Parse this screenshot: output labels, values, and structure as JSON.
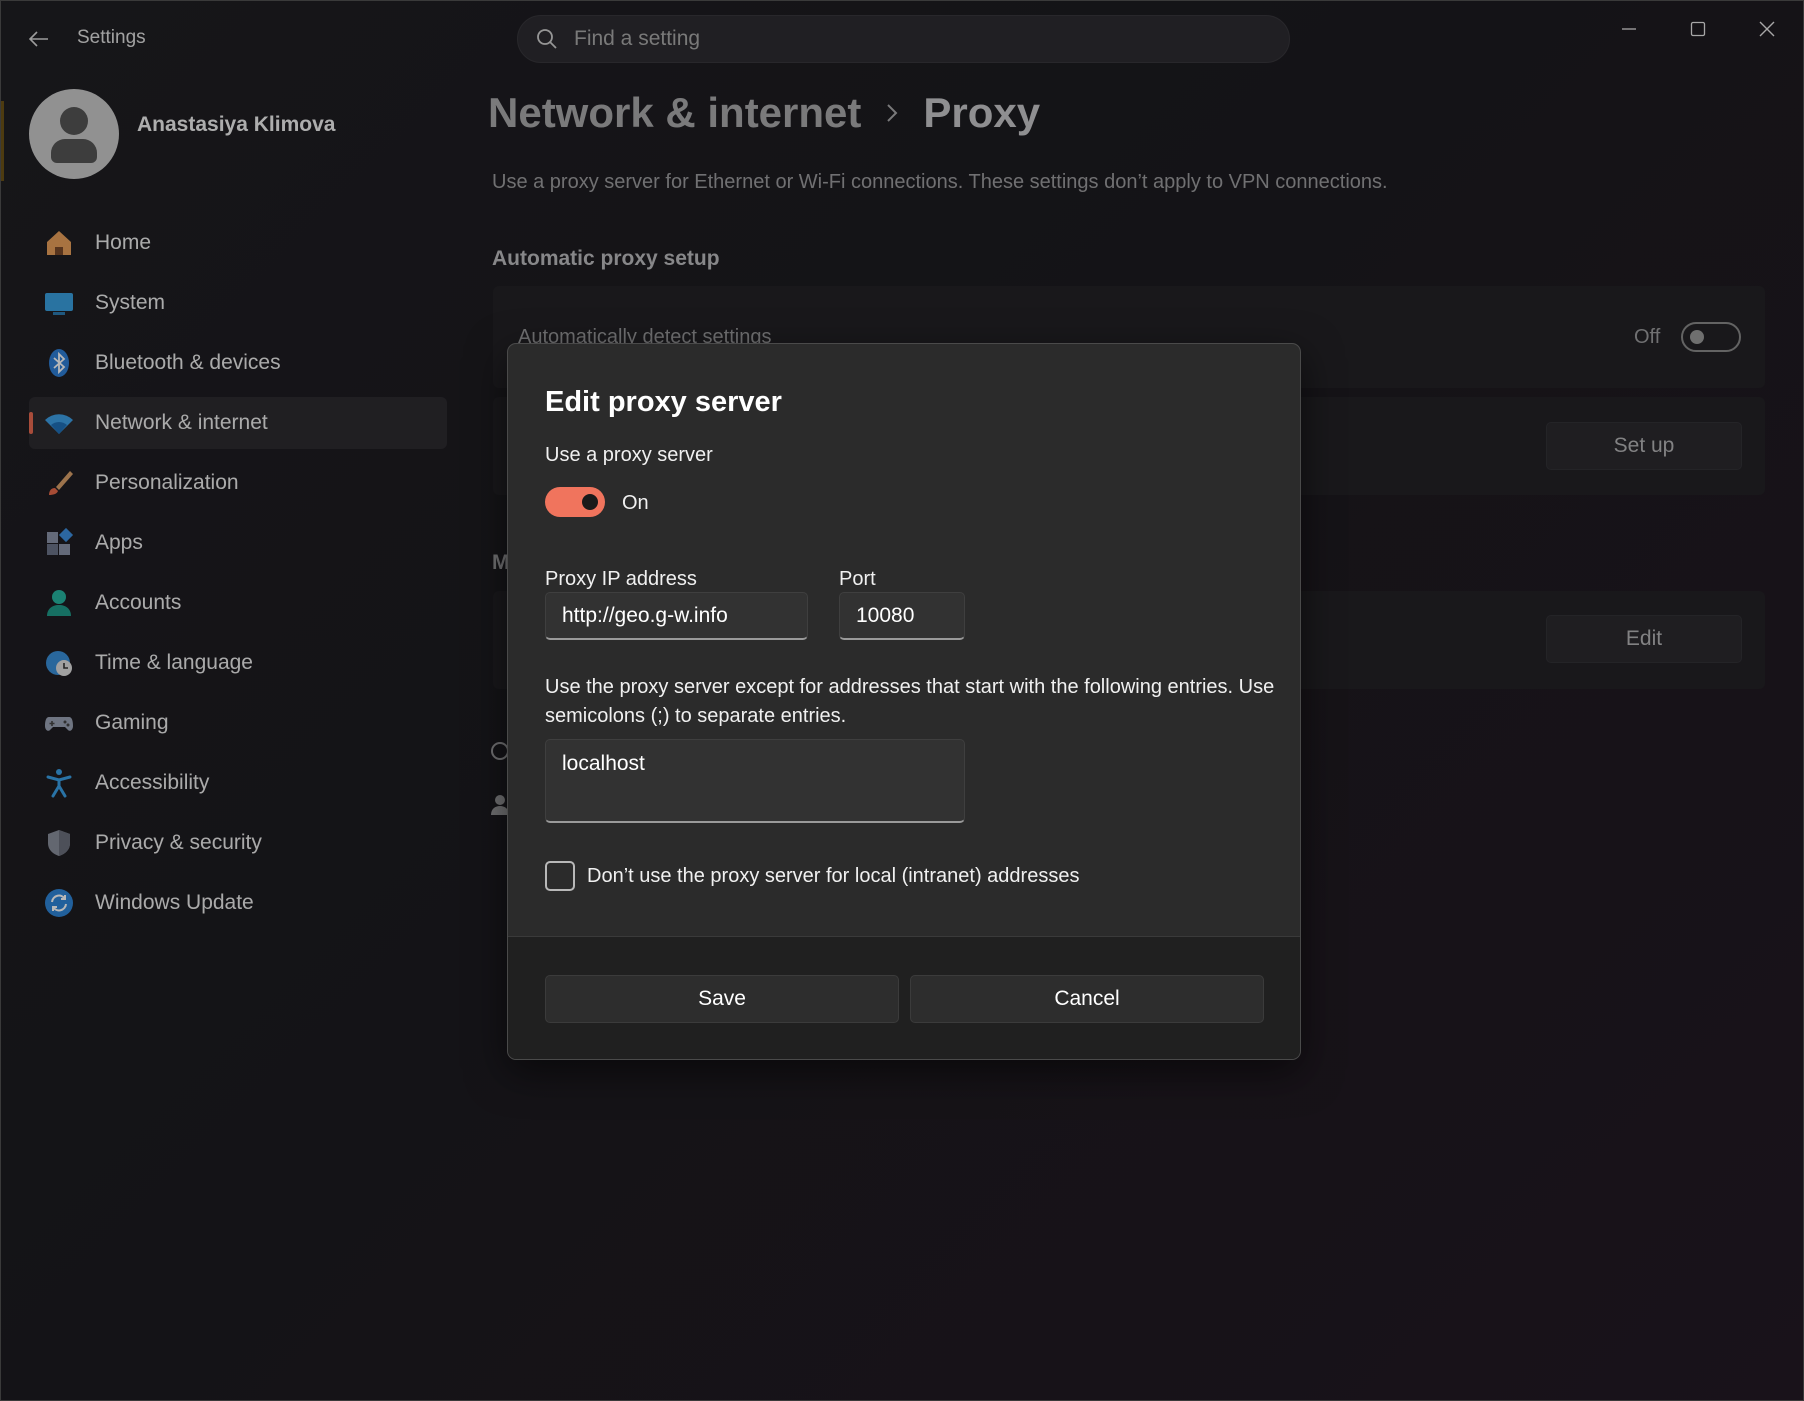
{
  "window": {
    "app_title": "Settings"
  },
  "search": {
    "placeholder": "Find a setting"
  },
  "profile": {
    "name": "Anastasiya Klimova"
  },
  "sidebar": {
    "items": [
      {
        "label": "Home",
        "icon": "home-icon"
      },
      {
        "label": "System",
        "icon": "system-icon"
      },
      {
        "label": "Bluetooth & devices",
        "icon": "bluetooth-icon"
      },
      {
        "label": "Network & internet",
        "icon": "wifi-icon",
        "active": true
      },
      {
        "label": "Personalization",
        "icon": "brush-icon"
      },
      {
        "label": "Apps",
        "icon": "apps-icon"
      },
      {
        "label": "Accounts",
        "icon": "accounts-icon"
      },
      {
        "label": "Time & language",
        "icon": "globe-clock-icon"
      },
      {
        "label": "Gaming",
        "icon": "gamepad-icon"
      },
      {
        "label": "Accessibility",
        "icon": "accessibility-icon"
      },
      {
        "label": "Privacy & security",
        "icon": "shield-icon"
      },
      {
        "label": "Windows Update",
        "icon": "update-icon"
      }
    ]
  },
  "main": {
    "breadcrumb_parent": "Network & internet",
    "breadcrumb_current": "Proxy",
    "description": "Use a proxy server for Ethernet or Wi-Fi connections. These settings don’t apply to VPN connections.",
    "section_automatic": "Automatic proxy setup",
    "auto_detect_label": "Automatically detect settings",
    "auto_detect_state": "Off",
    "setup_button": "Set up",
    "manual_section_partial": "M",
    "edit_button": "Edit"
  },
  "dialog": {
    "title": "Edit proxy server",
    "use_proxy_label": "Use a proxy server",
    "use_proxy_state": "On",
    "ip_label": "Proxy IP address",
    "ip_value": "http://geo.g-w.info",
    "port_label": "Port",
    "port_value": "10080",
    "exceptions_desc": "Use the proxy server except for addresses that start with the following entries. Use semicolons (;) to separate entries.",
    "exceptions_value": "localhost",
    "local_checkbox_label": "Don’t use the proxy server for local (intranet) addresses",
    "save_label": "Save",
    "cancel_label": "Cancel"
  },
  "colors": {
    "accent": "#f0745d",
    "background": "#1f1e22",
    "dialog_bg": "#2b2b2b"
  }
}
